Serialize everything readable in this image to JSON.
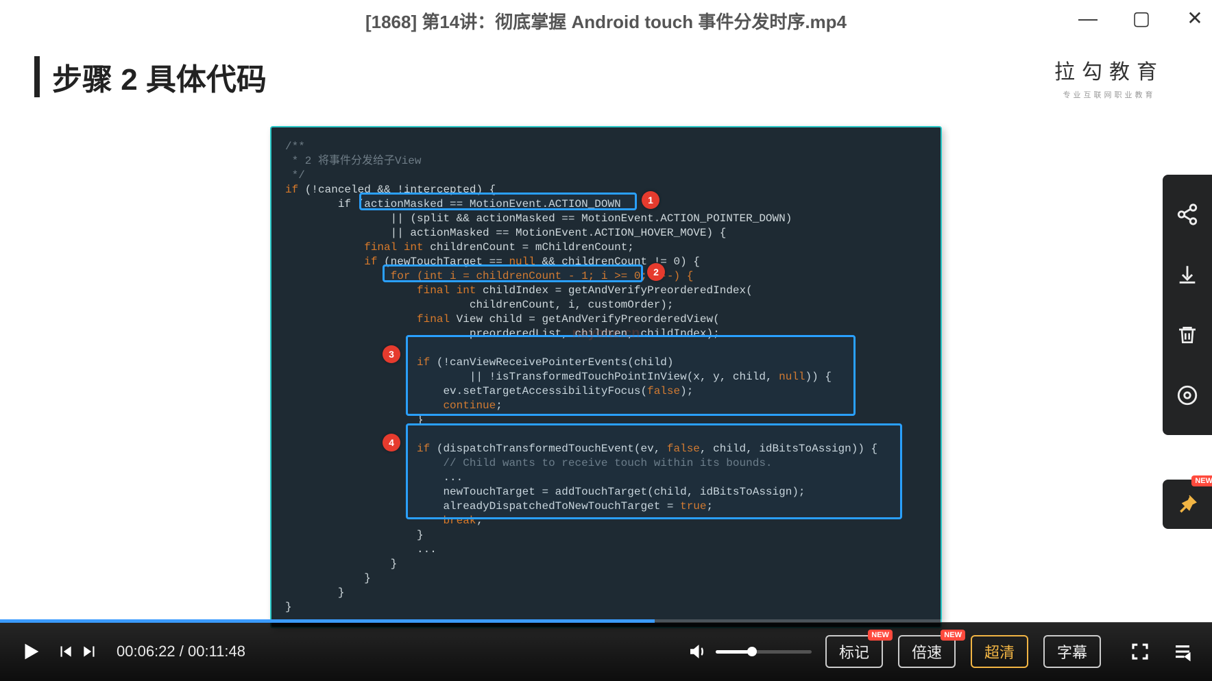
{
  "window": {
    "title": "[1868] 第14讲：彻底掌握 Android touch 事件分发时序.mp4"
  },
  "slide": {
    "heading": "步骤 2 具体代码",
    "brandMain": "拉勾教育",
    "brandSub": "专业互联网职业教育"
  },
  "code": {
    "comment1": "/**",
    "comment2": " * 2 将事件分发给子View",
    "comment3": " */",
    "l1a": "if",
    "l1b": " (!canceled && !intercepted) {",
    "l2a": "        if (",
    "l2b": "actionMasked == MotionEvent.ACTION_DOWN",
    "l3": "                || (split && actionMasked == MotionEvent.ACTION_POINTER_DOWN)",
    "l4": "                || actionMasked == MotionEvent.ACTION_HOVER_MOVE) {",
    "l5a": "            ",
    "l5b": "final int",
    "l5c": " childrenCount = mChildrenCount;",
    "l6a": "            ",
    "l6b": "if",
    "l6c": " (newTouchTarget == ",
    "l6d": "null",
    "l6e": " && childrenCount != 0) {",
    "l7a": "                ",
    "l7b": "for (int i = childrenCount - 1; i >= 0; i--) {",
    "l8a": "                    ",
    "l8b": "final int",
    "l8c": " childIndex = getAndVerifyPreorderedIndex(",
    "l9": "                            childrenCount, i, customOrder);",
    "l10a": "                    ",
    "l10b": "final",
    "l10c": " View child = getAndVerifyPreorderedView(",
    "l11": "                            preorderedList, children, childIndex);",
    "blank1": "",
    "l12a": "                    ",
    "l12b": "if",
    "l12c": " (!canViewReceivePointerEvents(child)",
    "l13a": "                            || !isTransformedTouchPointInView(x, y, child, ",
    "l13b": "null",
    "l13c": ")) {",
    "l14a": "                        ev.setTargetAccessibilityFocus(",
    "l14b": "false",
    "l14c": ");",
    "l15a": "                        ",
    "l15b": "continue",
    "l15c": ";",
    "l16": "                    }",
    "blank2": "",
    "l17a": "                    ",
    "l17b": "if",
    "l17c": " (dispatchTransformedTouchEvent(ev, ",
    "l17d": "false",
    "l17e": ", child, idBitsToAssign)) {",
    "l18": "                        // Child wants to receive touch within its bounds.",
    "l19": "                        ...",
    "l20": "                        newTouchTarget = addTouchTarget(child, idBitsToAssign);",
    "l21a": "                        alreadyDispatchedToNewTouchTarget = ",
    "l21b": "true",
    "l21c": ";",
    "l22a": "                        ",
    "l22b": "break",
    "l22c": ";",
    "l23": "                    }",
    "l24": "                    ...",
    "l25": "                }",
    "l26": "            }",
    "l27": "        }",
    "l28": "}"
  },
  "badges": {
    "one": "1",
    "two": "2",
    "three": "3",
    "four": "4"
  },
  "side": {
    "newLabel": "NEW"
  },
  "player": {
    "currentTime": "00:06:22",
    "sep": " / ",
    "duration": "00:11:48",
    "markLabel": "标记",
    "speedLabel": "倍速",
    "hdLabel": "超清",
    "subtitleLabel": "字幕",
    "newLabel": "NEW",
    "progressPercent": 54,
    "volumePercent": 38
  },
  "watermark": "nayone.cn"
}
